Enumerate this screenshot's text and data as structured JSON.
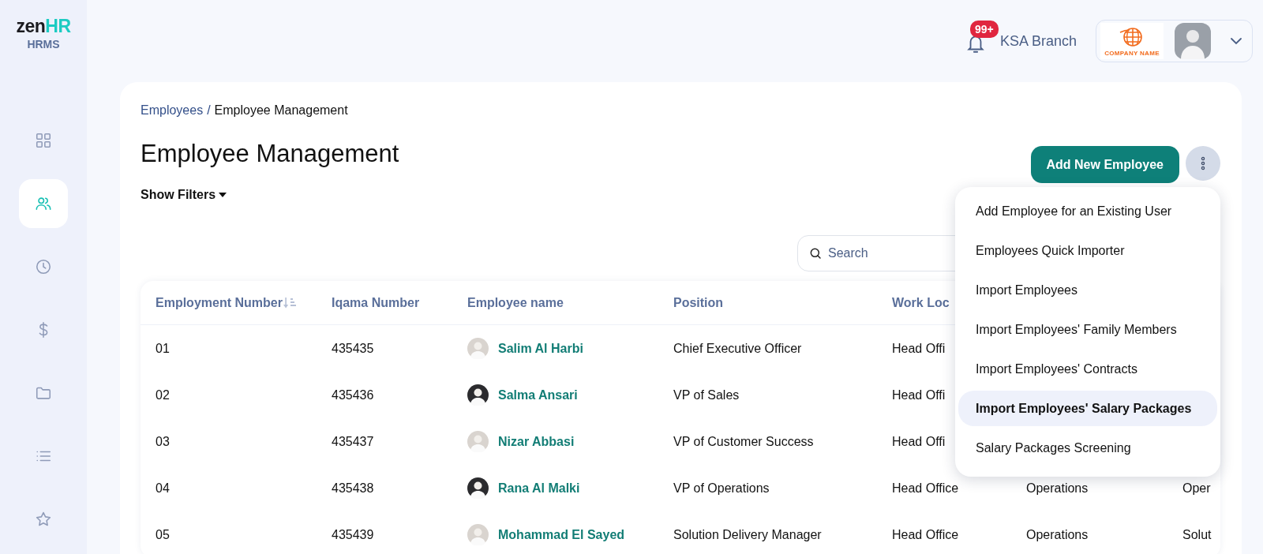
{
  "sidebar": {
    "logo": {
      "part_1": "zen",
      "part_2": "HR"
    },
    "product": "HRMS",
    "items": [
      {
        "kind": "grid",
        "selected": false
      },
      {
        "kind": "people",
        "selected": true
      },
      {
        "kind": "clock",
        "selected": false
      },
      {
        "kind": "dollar",
        "selected": false
      },
      {
        "kind": "folder",
        "selected": false
      },
      {
        "kind": "list",
        "selected": false
      },
      {
        "kind": "star",
        "selected": false
      }
    ]
  },
  "topbar": {
    "notification_badge": "99+",
    "branch": "KSA Branch",
    "company_logo_text": "COMPANY NAME"
  },
  "breadcrumb": {
    "link": "Employees",
    "separator": "/",
    "current": "Employee Management"
  },
  "title": "Employee Management",
  "filter_toggle": "Show Filters",
  "primary_button": "Add New Employee",
  "search": {
    "placeholder": "Search"
  },
  "table": {
    "columns": [
      {
        "label": "Employment Number",
        "sorted": true
      },
      {
        "label": "Iqama Number",
        "sorted": false
      },
      {
        "label": "Employee name",
        "sorted": false
      },
      {
        "label": "Position",
        "sorted": false
      },
      {
        "label": "Work Loc",
        "sorted": false
      }
    ],
    "rows": [
      {
        "number": "01",
        "iqama": "435435",
        "name": "Salim Al Harbi",
        "position": "Chief Executive Officer",
        "work_location": "Head Offi"
      },
      {
        "number": "02",
        "iqama": "435436",
        "name": "Salma Ansari",
        "position": "VP of Sales",
        "work_location": "Head Offi"
      },
      {
        "number": "03",
        "iqama": "435437",
        "name": "Nizar Abbasi",
        "position": "VP of Customer Success",
        "work_location": "Head Offi"
      },
      {
        "number": "04",
        "iqama": "435438",
        "name": "Rana Al Malki",
        "position": "VP of Operations",
        "work_location": "Head Office",
        "column_6": "Operations",
        "column_7": "Oper"
      },
      {
        "number": "05",
        "iqama": "435439",
        "name": "Mohammad El Sayed",
        "position": "Solution Delivery Manager",
        "work_location": "Head Office",
        "column_6": "Operations",
        "column_7": "Solut"
      }
    ]
  },
  "menu": {
    "items": [
      {
        "label": "Add Employee for an Existing User",
        "selected": false
      },
      {
        "label": "Employees Quick Importer",
        "selected": false
      },
      {
        "label": "Import Employees",
        "selected": false
      },
      {
        "label": "Import Employees' Family Members",
        "selected": false
      },
      {
        "label": "Import Employees' Contracts",
        "selected": false
      },
      {
        "label": "Import Employees' Salary Packages",
        "selected": true
      },
      {
        "label": "Salary Packages Screening",
        "selected": false
      }
    ]
  }
}
